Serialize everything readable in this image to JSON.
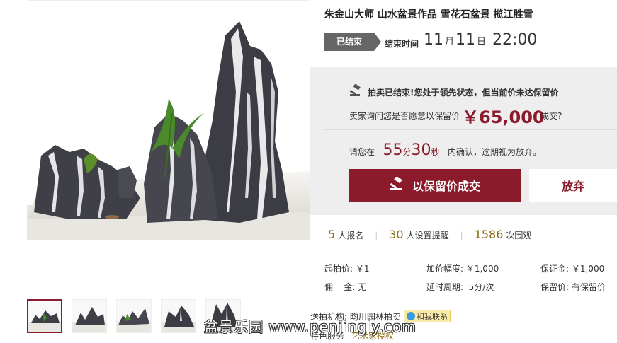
{
  "item": {
    "title": "朱金山大师 山水盆景作品 雪花石盆景 揽江胜雪"
  },
  "status": {
    "badge": "已结束",
    "end_label": "结束时间",
    "end_month": "11",
    "month_unit": "月",
    "end_day": "11",
    "day_unit": "日",
    "end_clock": "22:00"
  },
  "notice": {
    "title": "拍卖已结束!您处于领先状态，但当前价未达保留价",
    "question_prefix": "卖家询问您是否愿意以保留价",
    "reserve_price": "￥65,000",
    "question_suffix": "成交?",
    "countdown_prefix": "请您在",
    "minutes": "55",
    "minute_unit": "分",
    "seconds": "30",
    "second_unit": "秒",
    "countdown_suffix": "内确认，逾期视为放弃。",
    "accept_label": "以保留价成交",
    "decline_label": "放弃"
  },
  "stats": [
    {
      "num": "5",
      "label": "人报名"
    },
    {
      "num": "30",
      "label": "人设置提醒"
    },
    {
      "num": "1586",
      "label": "次围观"
    }
  ],
  "details": {
    "start_price": "起拍价: ￥1",
    "increment": "加价幅度: ￥1,000",
    "deposit": "保证金: ￥1,000",
    "commission": "佣    金: 无",
    "delay": "延时周期:  5分/次",
    "reserve": "保留价: 有保留价"
  },
  "agency": {
    "label": "送拍机构: 昀川园林拍卖",
    "contact": "和我联系"
  },
  "service": {
    "label": "特色服务",
    "value": "艺术家授权"
  },
  "watermark": "盆景乐园 www.penjingly.com",
  "colors": {
    "accent": "#8b1a2b",
    "badge": "#666666",
    "panel": "#eeeeee",
    "stat_number": "#8b6914"
  }
}
